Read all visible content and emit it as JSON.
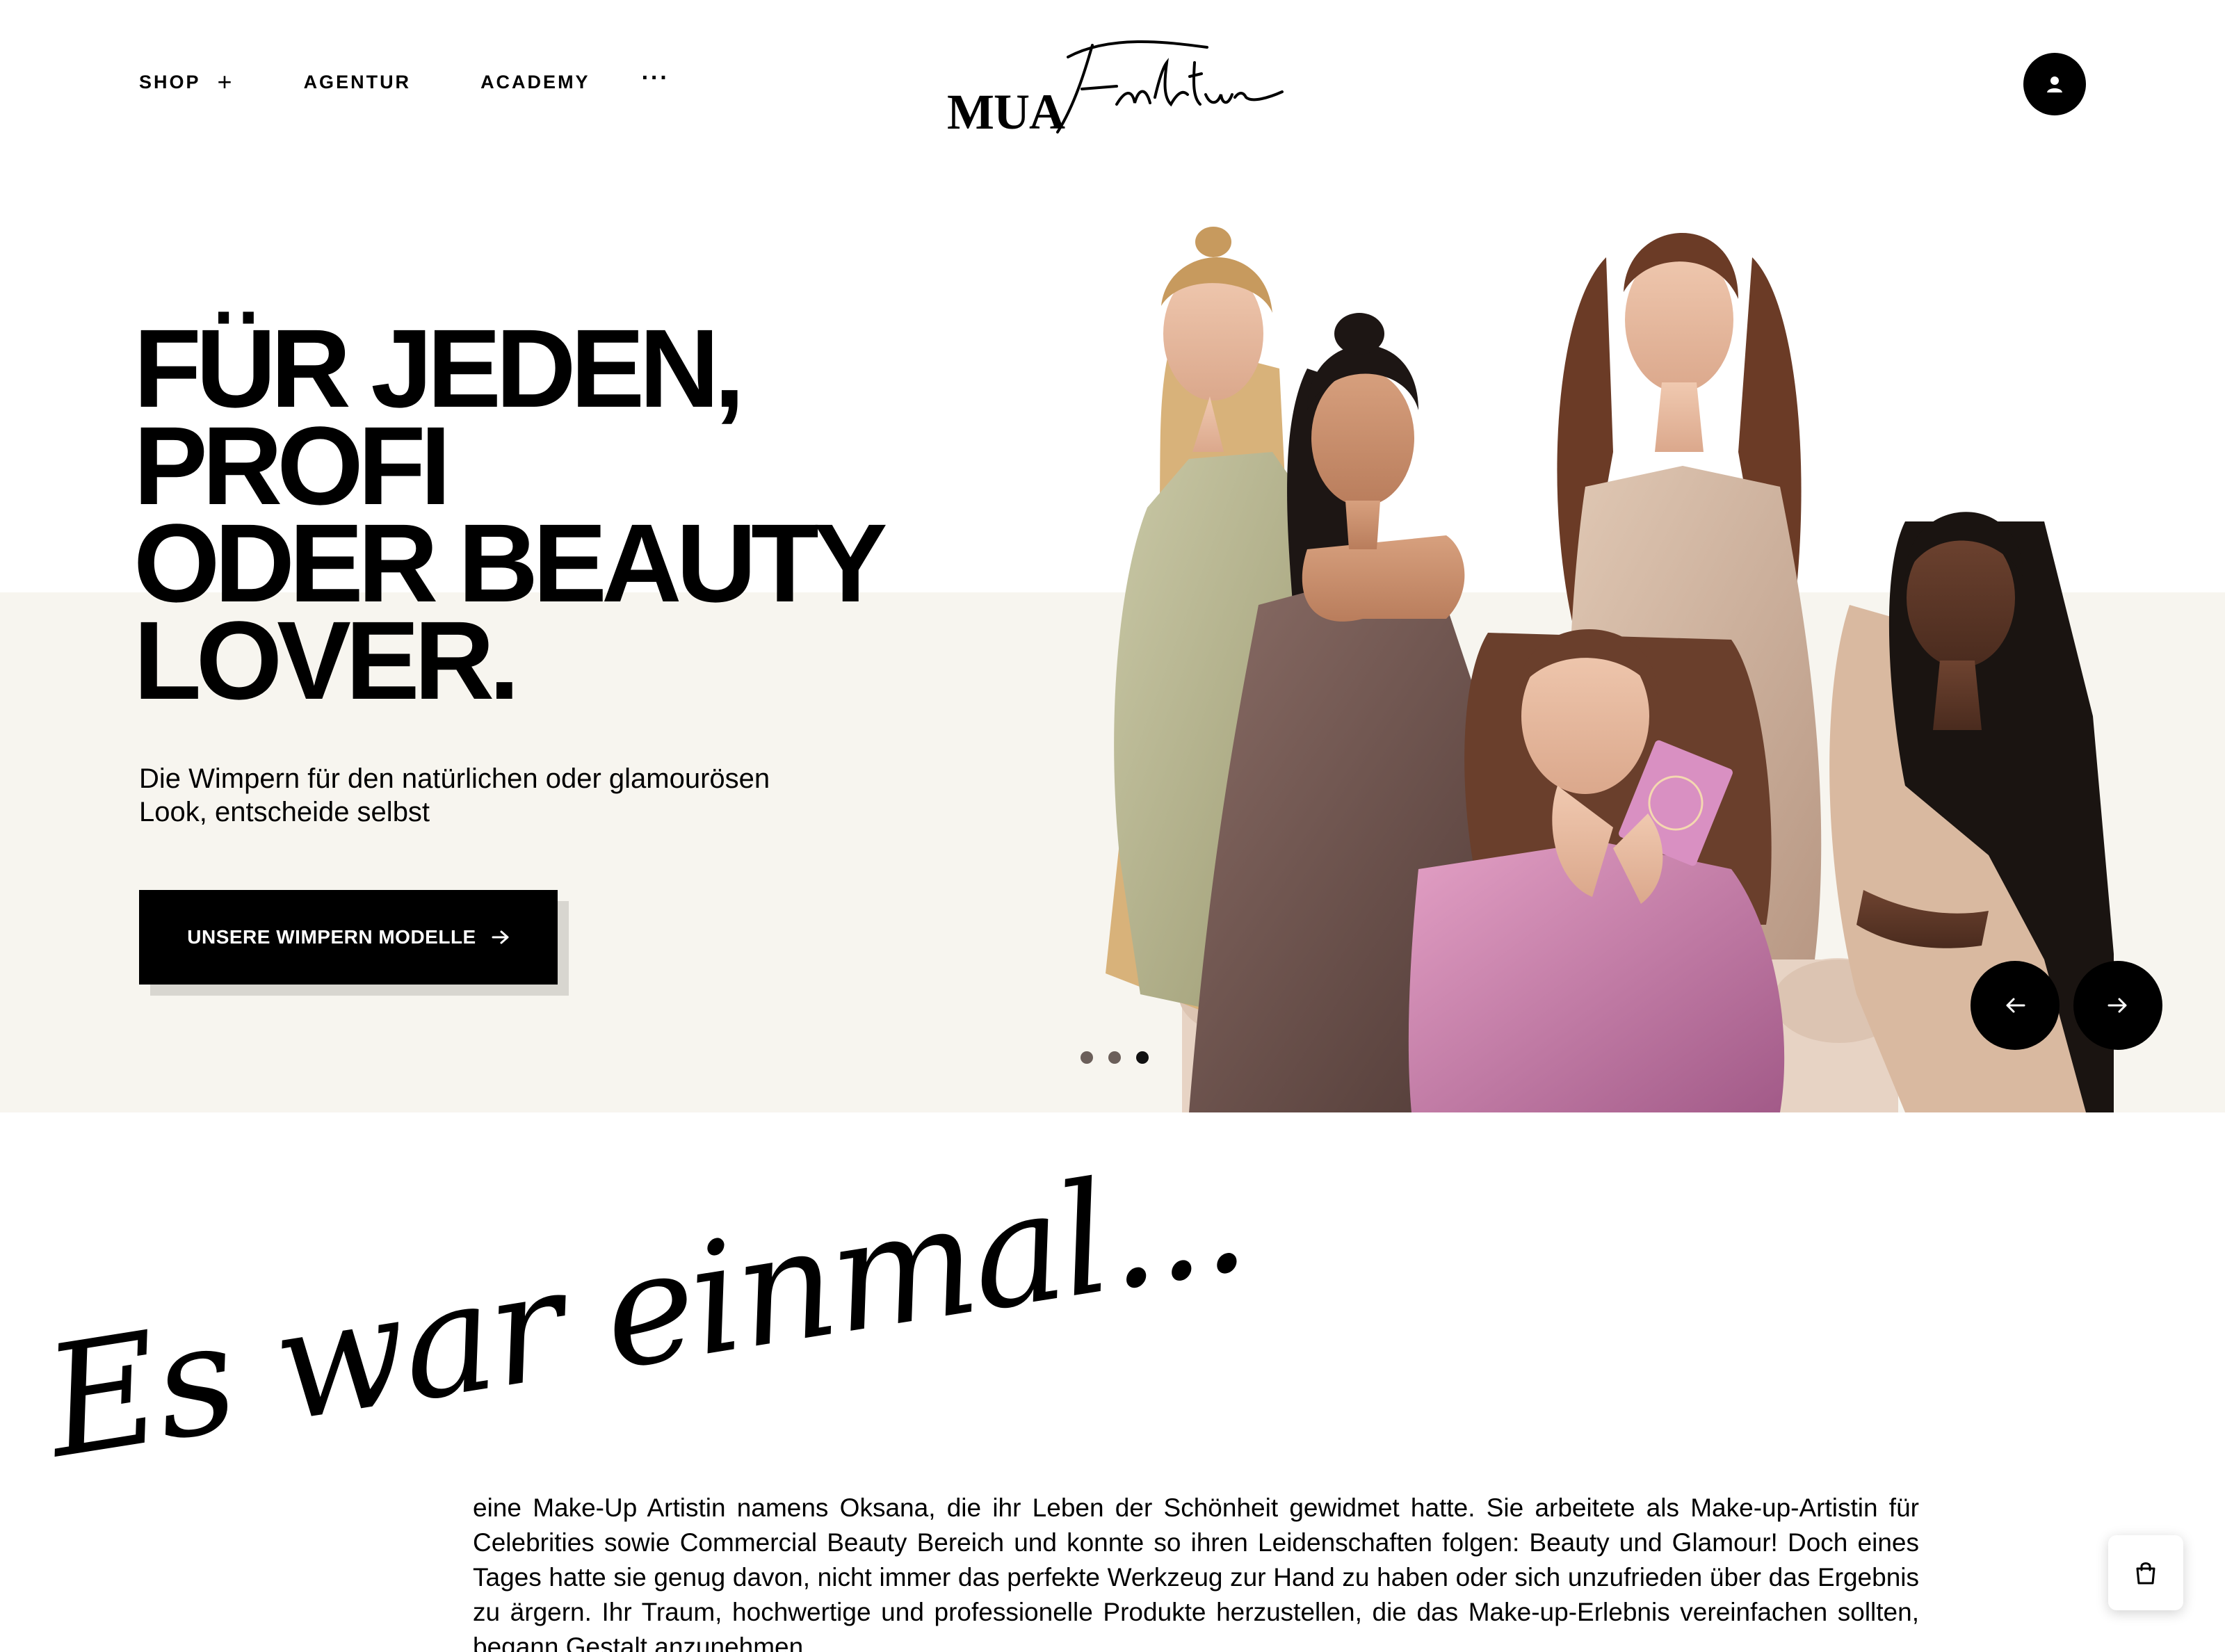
{
  "nav": {
    "shop": "SHOP",
    "shop_expand": "+",
    "agentur": "AGENTUR",
    "academy": "ACADEMY",
    "more": "···"
  },
  "logo": {
    "brand": "MUA",
    "script": "Faktur"
  },
  "hero": {
    "title_lines": [
      "FÜR JEDEN,",
      "PROFI",
      "ODER BEAUTY",
      "LOVER."
    ],
    "subtitle": "Die Wimpern für den natürlichen oder glamourösen Look, entscheide selbst",
    "cta_label": "UNSERE WIMPERN MODELLE",
    "slides": {
      "count": 3,
      "active": 3
    },
    "colors": {
      "band": "#f7f5ef",
      "cta": "#000000"
    }
  },
  "story": {
    "heading": "Es war einmal...",
    "text": "eine Make-Up Artistin namens Oksana, die ihr Leben der Schönheit gewidmet hatte. Sie arbeitete als Make-up-Artistin für Celebrities sowie Commercial Beauty Bereich und konnte so ihren Leidenschaften folgen: Beauty und Glamour! Doch eines Tages hatte sie genug davon, nicht immer das perfekte Werkzeug zur Hand zu haben oder sich unzufrieden über das Ergebnis zu ärgern. Ihr Traum, hochwertige und professionelle Produkte herzustellen, die das Make-up-Erlebnis vereinfachen sollten, begann Gestalt anzunehmen."
  },
  "icons": {
    "account": "user-icon",
    "prev": "arrow-left-icon",
    "next": "arrow-right-icon",
    "cart": "shopping-bag-icon"
  }
}
